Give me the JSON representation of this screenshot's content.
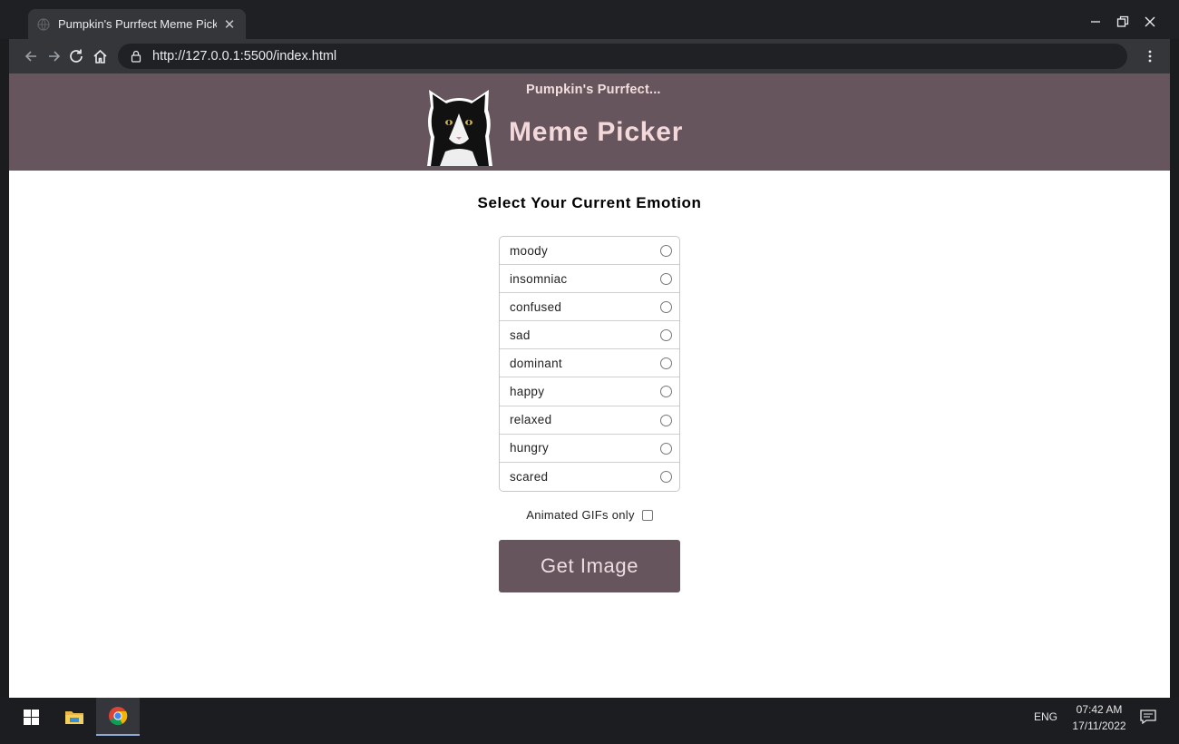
{
  "browser": {
    "tab_title": "Pumpkin's Purrfect Meme Picker",
    "url": "http://127.0.0.1:5500/index.html"
  },
  "header": {
    "subtitle": "Pumpkin's Purrfect...",
    "title": "Meme Picker"
  },
  "main": {
    "heading": "Select Your Current Emotion",
    "emotions": [
      "moody",
      "insomniac",
      "confused",
      "sad",
      "dominant",
      "happy",
      "relaxed",
      "hungry",
      "scared"
    ],
    "gif_label": "Animated GIFs only",
    "gif_checked": false,
    "button_label": "Get Image"
  },
  "taskbar": {
    "lang": "ENG",
    "time": "07:42 AM",
    "date": "17/11/2022"
  },
  "colors": {
    "brand": "#66555c",
    "header_text": "#f4d9dc",
    "button_text": "#eddde1"
  }
}
